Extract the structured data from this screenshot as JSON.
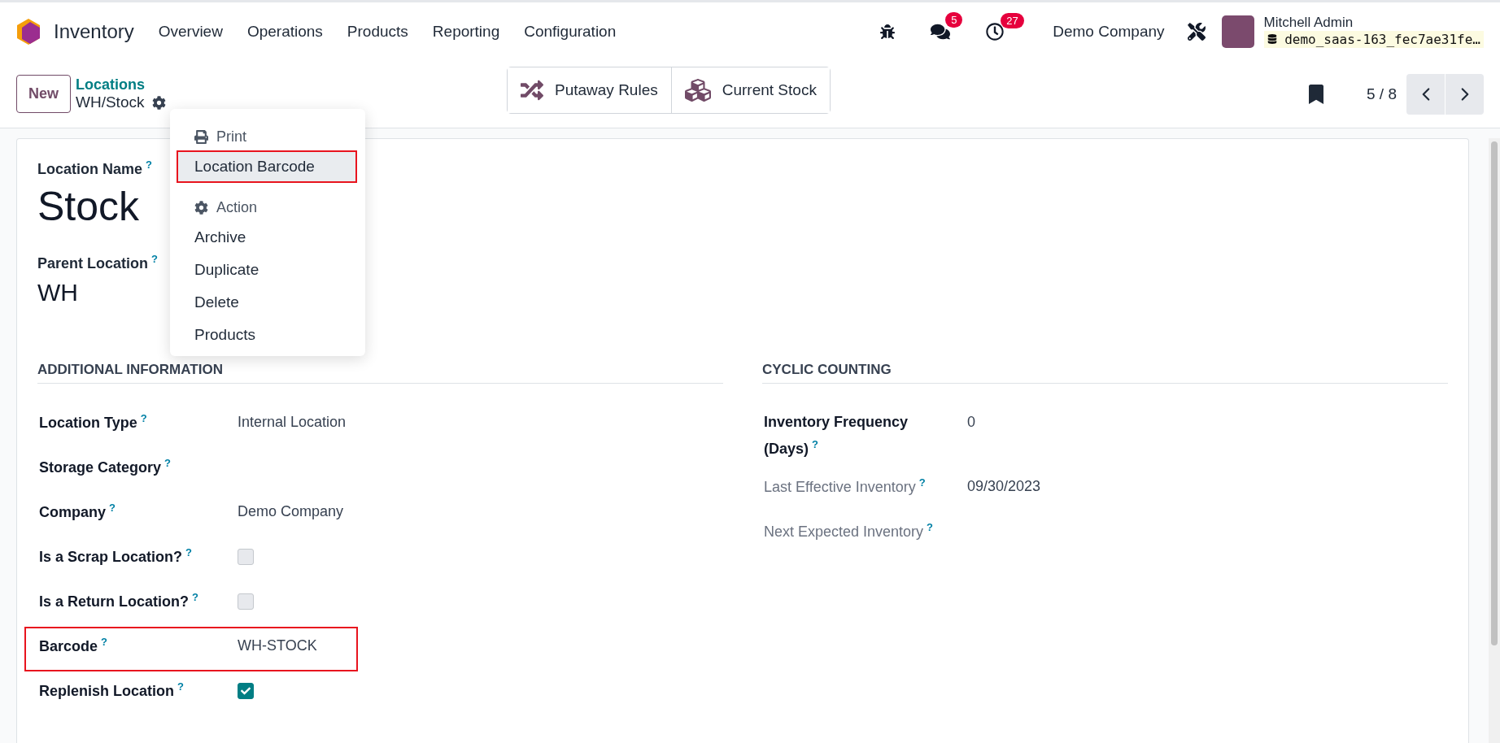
{
  "app": {
    "name": "Inventory"
  },
  "menu": [
    {
      "label": "Overview"
    },
    {
      "label": "Operations"
    },
    {
      "label": "Products"
    },
    {
      "label": "Reporting"
    },
    {
      "label": "Configuration"
    }
  ],
  "systray": {
    "messages_count": "5",
    "activities_count": "27",
    "company": "Demo Company",
    "user": {
      "name": "Mitchell Admin",
      "database": "demo_saas-163_fec7ae31fe…"
    }
  },
  "control_panel": {
    "new_button": "New",
    "breadcrumb": {
      "parent": "Locations",
      "current": "WH/Stock"
    },
    "smart_buttons": [
      {
        "label": "Putaway Rules"
      },
      {
        "label": "Current Stock"
      }
    ],
    "pager": "5 / 8"
  },
  "action_menu": {
    "sections": [
      {
        "title": "Print",
        "items": [
          {
            "label": "Location Barcode",
            "highlighted": true
          }
        ]
      },
      {
        "title": "Action",
        "items": [
          {
            "label": "Archive",
            "highlighted": false
          },
          {
            "label": "Duplicate",
            "highlighted": false
          },
          {
            "label": "Delete",
            "highlighted": false
          },
          {
            "label": "Products",
            "highlighted": false
          }
        ]
      }
    ]
  },
  "form": {
    "name_label": "Location Name",
    "name_help": "?",
    "name": "Stock",
    "parent_label": "Parent Location",
    "parent_help": "?",
    "parent": "WH",
    "groups": [
      {
        "title": "ADDITIONAL INFORMATION",
        "fields": [
          {
            "kind": "text",
            "label": "Location Type",
            "help": "?",
            "value": "Internal Location",
            "readonly": false,
            "highlighted": false
          },
          {
            "kind": "text",
            "label": "Storage Category",
            "help": "?",
            "readonly": false,
            "highlighted": false
          },
          {
            "kind": "text",
            "label": "Company",
            "help": "?",
            "value": "Demo Company",
            "readonly": false,
            "highlighted": false
          },
          {
            "kind": "checkbox",
            "label": "Is a Scrap Location?",
            "help": "?",
            "checked": false,
            "readonly": false,
            "highlighted": false
          },
          {
            "kind": "checkbox",
            "label": "Is a Return Location?",
            "help": "?",
            "checked": false,
            "readonly": false,
            "highlighted": false
          },
          {
            "kind": "text",
            "label": "Barcode",
            "help": "?",
            "value": "WH-STOCK",
            "readonly": false,
            "highlighted": true
          },
          {
            "kind": "checkbox",
            "label": "Replenish Location",
            "help": "?",
            "checked": true,
            "readonly": false,
            "highlighted": false
          }
        ]
      },
      {
        "title": "CYCLIC COUNTING",
        "fields": [
          {
            "kind": "text",
            "label": "Inventory Frequency (Days)",
            "help": "?",
            "value": "0",
            "readonly": false,
            "highlighted": false
          },
          {
            "kind": "text",
            "label": "Last Effective Inventory",
            "help": "?",
            "value": "09/30/2023",
            "readonly": true,
            "highlighted": false
          },
          {
            "kind": "text",
            "label": "Next Expected Inventory",
            "help": "?",
            "readonly": true,
            "highlighted": false
          }
        ]
      }
    ]
  }
}
